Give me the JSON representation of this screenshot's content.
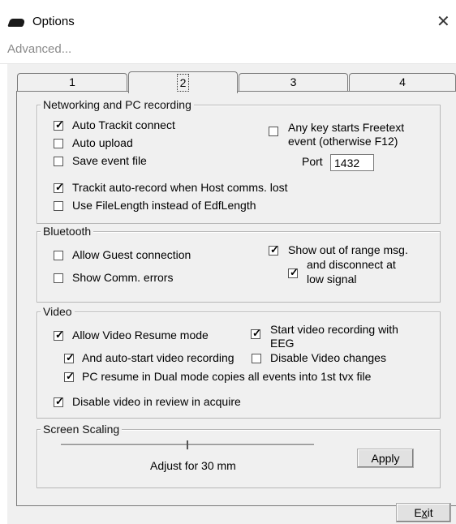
{
  "window": {
    "title": "Options",
    "close_glyph": "✕"
  },
  "advanced_link": "Advanced...",
  "tabs": [
    {
      "label": "1",
      "active": false
    },
    {
      "label": "2",
      "active": true
    },
    {
      "label": "3",
      "active": false
    },
    {
      "label": "4",
      "active": false
    }
  ],
  "networking": {
    "legend": "Networking and PC recording",
    "auto_trackit": {
      "label": "Auto Trackit connect",
      "checked": true
    },
    "auto_upload": {
      "label": "Auto upload",
      "checked": false
    },
    "save_event": {
      "label": "Save event file",
      "checked": false
    },
    "any_key": {
      "label_line1": "Any key starts Freetext",
      "label_line2": "event (otherwise F12)",
      "checked": false
    },
    "port_label": "Port",
    "port_value": "1432",
    "trackit_auto_record": {
      "label": "Trackit auto-record when Host comms. lost",
      "checked": true
    },
    "use_filelength": {
      "label": "Use FileLength instead of EdfLength",
      "checked": false
    }
  },
  "bluetooth": {
    "legend": "Bluetooth",
    "allow_guest": {
      "label": "Allow Guest connection",
      "checked": false
    },
    "show_comm_errors": {
      "label": "Show Comm. errors",
      "checked": false
    },
    "show_out_of_range": {
      "label": "Show out of range msg.",
      "checked": true
    },
    "disconnect_low": {
      "label_line1": "and disconnect at",
      "label_line2": "low signal",
      "checked": true
    }
  },
  "video": {
    "legend": "Video",
    "allow_resume": {
      "label": "Allow Video Resume mode",
      "checked": true
    },
    "start_with_eeg": {
      "label_line1": "Start video recording with",
      "label_line2": "EEG",
      "checked": true
    },
    "auto_start": {
      "label": "And auto-start video recording",
      "checked": true
    },
    "disable_changes": {
      "label": "Disable Video changes",
      "checked": false
    },
    "pc_resume_dual": {
      "label": "PC resume in Dual mode copies all events into 1st tvx file",
      "checked": true
    },
    "disable_review": {
      "label": "Disable video in review in acquire",
      "checked": true
    }
  },
  "scaling": {
    "legend": "Screen Scaling",
    "slider_fraction": 0.5,
    "caption": "Adjust for 30 mm",
    "apply_label": "Apply"
  },
  "exit_prefix": "E",
  "exit_underlined": "x",
  "exit_suffix": "it",
  "check_glyph": "✓"
}
